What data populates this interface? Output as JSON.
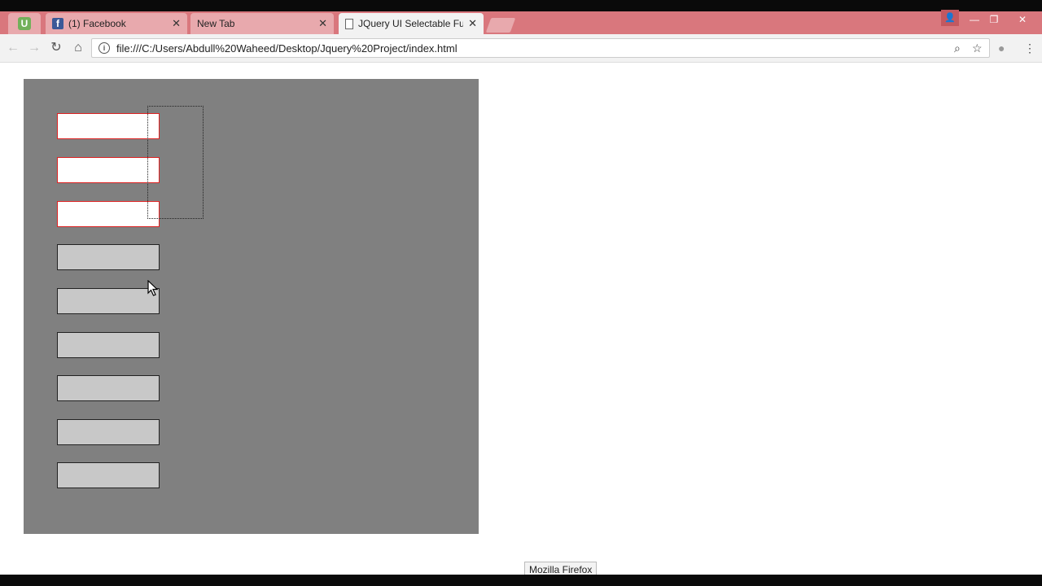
{
  "tabs": [
    {
      "label": "(1) Facebook",
      "icon": "facebook-icon"
    },
    {
      "label": "New Tab",
      "icon": "none"
    },
    {
      "label": "JQuery UI Selectable Fun",
      "icon": "document-icon",
      "active": true
    }
  ],
  "address_bar": {
    "url": "file:///C:/Users/Abdull%20Waheed/Desktop/Jquery%20Project/index.html"
  },
  "selectable": {
    "items_total": 9,
    "items_selecting": 3,
    "selecting_border_color": "#dd2222",
    "container_color": "#808080",
    "item_color": "#c8c8c8"
  },
  "status_tooltip": "Mozilla Firefox",
  "colors": {
    "tabstrip": "#d9777d",
    "tab_inactive": "#e8a9ad"
  }
}
